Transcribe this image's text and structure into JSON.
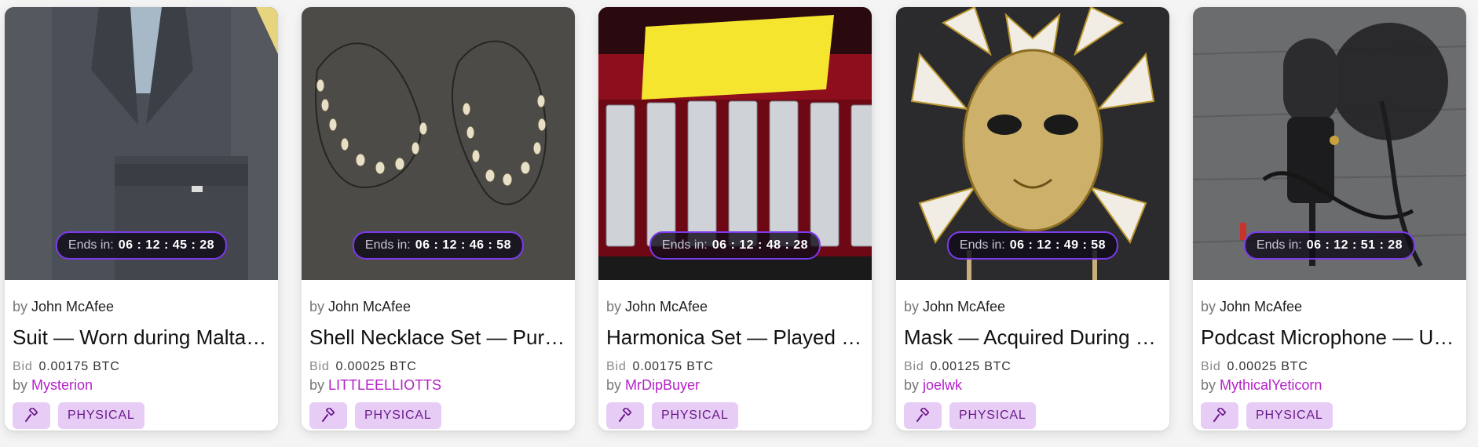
{
  "labels": {
    "ends_in": "Ends in:",
    "by": "by",
    "bid": "Bid"
  },
  "colors": {
    "accent": "#b521c9",
    "timer_border": "#7c3aed",
    "badge_bg": "#e7cdf6"
  },
  "cards": [
    {
      "creator": "John McAfee",
      "title": "Suit — Worn during Malta Bl…",
      "timer": "06 : 12 : 45 : 28",
      "bid_amount": "0.00175 BTC",
      "bidder": "Mysterion",
      "tag": "PHYSICAL",
      "action_icon": "gavel-icon"
    },
    {
      "creator": "John McAfee",
      "title": "Shell Necklace Set — Purch…",
      "timer": "06 : 12 : 46 : 58",
      "bid_amount": "0.00025 BTC",
      "bidder": "LITTLEELLIOTTS",
      "tag": "PHYSICAL",
      "action_icon": "gavel-icon"
    },
    {
      "creator": "John McAfee",
      "title": "Harmonica Set — Played By …",
      "timer": "06 : 12 : 48 : 28",
      "bid_amount": "0.00175 BTC",
      "bidder": "MrDipBuyer",
      "tag": "PHYSICAL",
      "action_icon": "gavel-icon"
    },
    {
      "creator": "John McAfee",
      "title": "Mask — Acquired During a E…",
      "timer": "06 : 12 : 49 : 58",
      "bid_amount": "0.00125 BTC",
      "bidder": "joelwk",
      "tag": "PHYSICAL",
      "action_icon": "gavel-icon"
    },
    {
      "creator": "John McAfee",
      "title": "Podcast Microphone — Use…",
      "timer": "06 : 12 : 51 : 28",
      "bid_amount": "0.00025 BTC",
      "bidder": "MythicalYeticorn",
      "tag": "PHYSICAL",
      "action_icon": "gavel-icon"
    }
  ]
}
